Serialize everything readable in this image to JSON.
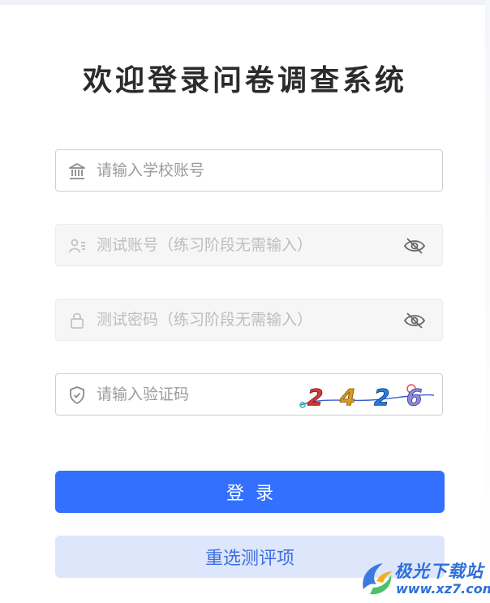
{
  "title": "欢迎登录问卷调查系统",
  "fields": {
    "school": {
      "placeholder": "请输入学校账号",
      "icon": "bank-icon"
    },
    "account": {
      "placeholder": "测试账号（练习阶段无需输入）",
      "icon": "user-card-icon",
      "toggle_icon": "eye-off-icon"
    },
    "password": {
      "placeholder": "测试密码（练习阶段无需输入）",
      "icon": "lock-icon",
      "toggle_icon": "eye-off-icon"
    },
    "captcha": {
      "placeholder": "请输入验证码",
      "icon": "shield-check-icon",
      "code": [
        "2",
        "4",
        "2",
        "6"
      ]
    }
  },
  "buttons": {
    "login": "登录",
    "reselect": "重选测评项"
  },
  "watermark": {
    "name": "极光下载站",
    "url": "www.xz7.com"
  },
  "colors": {
    "primary": "#3370ff",
    "secondary_bg": "#dde6fb",
    "secondary_text": "#3e6fe0"
  }
}
